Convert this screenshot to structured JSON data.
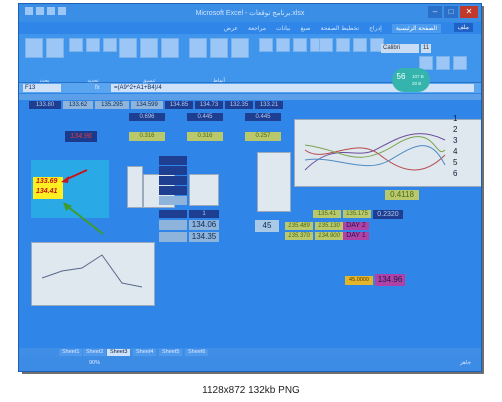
{
  "window": {
    "title": "Microsoft Excel - برنامج توقعات.xlsx",
    "minimize": "–",
    "maximize": "□",
    "close": "✕"
  },
  "ribbon": {
    "tabs": [
      "عرض",
      "مراجعة",
      "بيانات",
      "صيغ",
      "تخطيط الصفحة",
      "إدراج",
      "الصفحة الرئيسية"
    ],
    "file_tab": "ملف",
    "font_name": "Calibri",
    "font_size": "11",
    "groups": [
      "بحث",
      "تحديد",
      "تنسيق",
      "حذف",
      "إدراج",
      "أنماط",
      "تنسيق كجدول",
      "تنسيق شرطي"
    ]
  },
  "formula_bar": {
    "name_box": "F13",
    "fx": "fx",
    "formula": "=(A9^2+A1+B4)/4"
  },
  "cells": {
    "row1": [
      "133.80",
      "133.62",
      "135.295",
      "134.599",
      "134.85",
      "134.73",
      "132.35",
      "133.21"
    ],
    "blue_vals": [
      "0.696",
      "0.445",
      "0.445"
    ],
    "main_val": "134.96",
    "olive_vals": [
      "0.316",
      "0.316",
      "0.257"
    ],
    "yellow1": "133.69",
    "yellow2": "134.41",
    "green_val": "0.4118",
    "mid_vals": [
      "1",
      "134.06",
      "134.35"
    ],
    "val_45": "45",
    "r1": [
      "135.41",
      "135.175",
      "0.2320"
    ],
    "r2": [
      "135.489",
      "135.130",
      "DAY 2"
    ],
    "r3": [
      "135.370",
      "134.900",
      "DAY 1"
    ],
    "bottom1": "45.0000",
    "bottom2": "134.96"
  },
  "row_labels": [
    "1",
    "2",
    "3",
    "4",
    "5",
    "6"
  ],
  "sheet_tabs": [
    "Sheet1",
    "Sheet2",
    "Sheet3",
    "Sheet4",
    "Sheet5",
    "Sheet6"
  ],
  "active_sheet_index": 2,
  "status": {
    "zoom": "90%",
    "ready": "جاهز"
  },
  "clock": {
    "value": "56",
    "unit": "%",
    "line1": "107 B",
    "line2": "20 B"
  },
  "footer": {
    "text": "1128x872  132kb  PNG"
  }
}
